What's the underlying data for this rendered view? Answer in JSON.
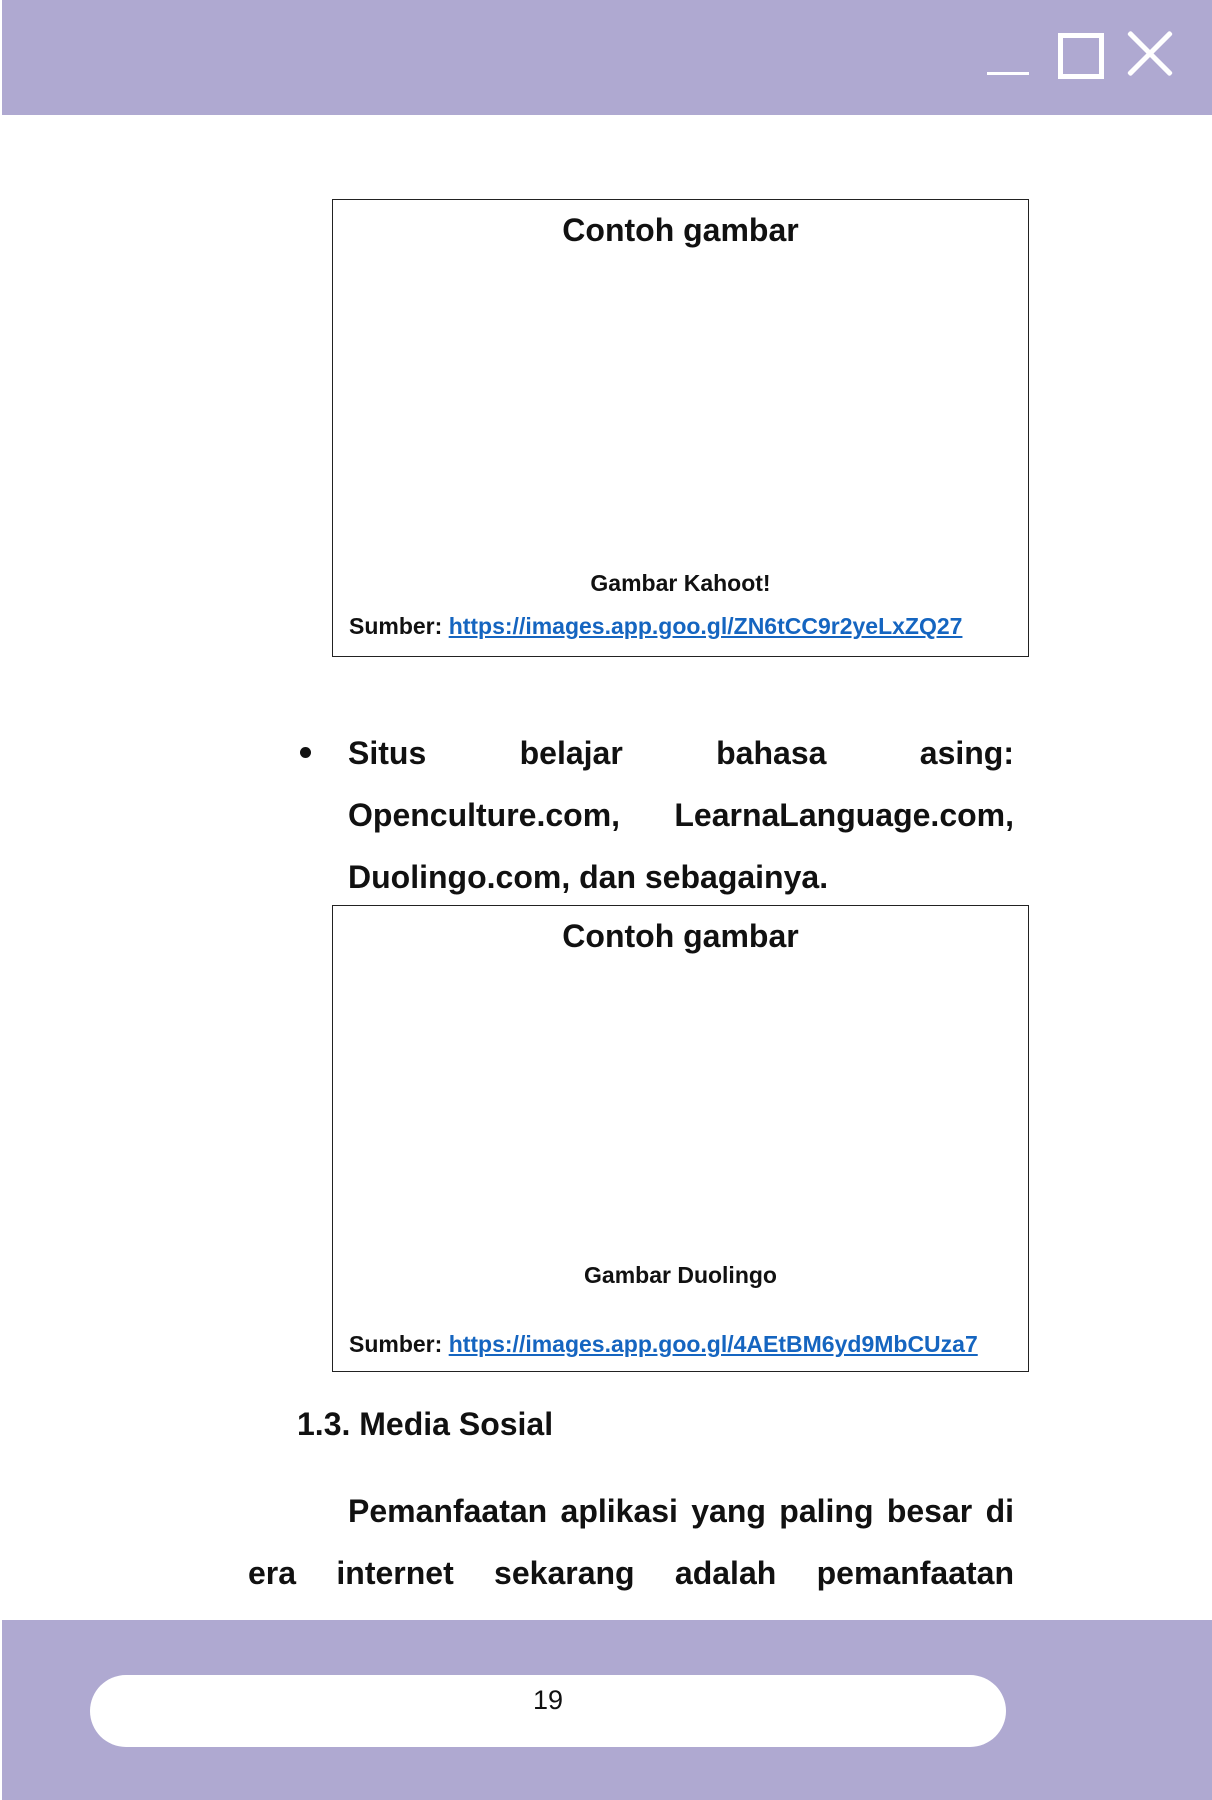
{
  "window_controls": {
    "minimize_icon": "minimize-icon",
    "maximize_icon": "maximize-icon",
    "close_icon": "close-icon",
    "bar_color": "#afa9d1"
  },
  "figure1": {
    "title": "Contoh gambar",
    "caption": "Gambar Kahoot!",
    "source_label": "Sumber:",
    "source_url": "https://images.app.goo.gl/ZN6tCC9r2yeLxZQ27"
  },
  "bullet": {
    "text": "Situs belajar bahasa asing: Openculture.com, LearnaLanguage.com, Duolingo.com, dan sebagainya."
  },
  "figure2": {
    "title": "Contoh gambar",
    "caption": "Gambar Duolingo",
    "source_label": "Sumber:",
    "source_url": "https://images.app.goo.gl/4AEtBM6yd9MbCUza7"
  },
  "section": {
    "heading": "1.3. Media Sosial",
    "paragraph": "Pemanfaatan aplikasi yang paling besar di era internet sekarang adalah pemanfaatan aplikasi"
  },
  "footer": {
    "page_number": "19"
  },
  "colors": {
    "link": "#1565c0",
    "frame": "#afa9d1"
  }
}
